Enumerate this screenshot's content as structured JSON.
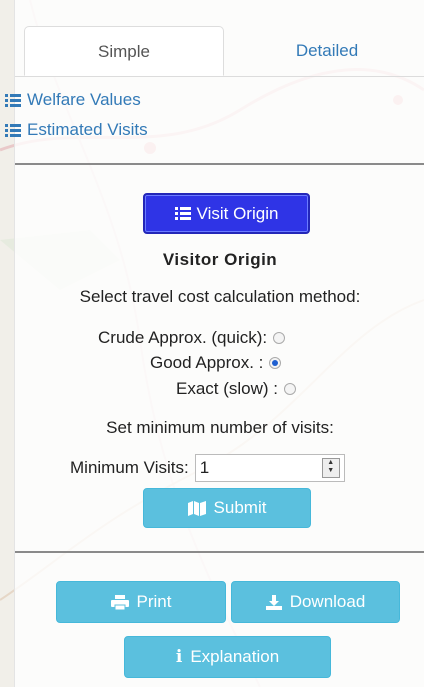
{
  "tabs": [
    {
      "label": "Simple",
      "active": true
    },
    {
      "label": "Detailed",
      "active": false
    }
  ],
  "side_links": [
    {
      "label": "Welfare Values",
      "icon": "list-icon"
    },
    {
      "label": "Estimated Visits",
      "icon": "list-icon"
    }
  ],
  "origin_button": {
    "label": "Visit Origin",
    "icon": "list-icon"
  },
  "section": {
    "title": "Visitor Origin",
    "method_prompt": "Select travel cost calculation method:",
    "methods": [
      {
        "label": "Crude Approx. (quick):",
        "checked": false
      },
      {
        "label": "Good Approx. :",
        "checked": true
      },
      {
        "label": "Exact (slow) :",
        "checked": false
      }
    ],
    "min_prompt": "Set minimum number of visits:",
    "min_label": "Minimum Visits:",
    "min_value": "1",
    "submit_label": "Submit"
  },
  "actions": {
    "print_label": "Print",
    "download_label": "Download",
    "explanation_label": "Explanation"
  },
  "colors": {
    "link": "#337ab7",
    "primary_active": "#2f34e6",
    "info": "#5bc0de"
  }
}
